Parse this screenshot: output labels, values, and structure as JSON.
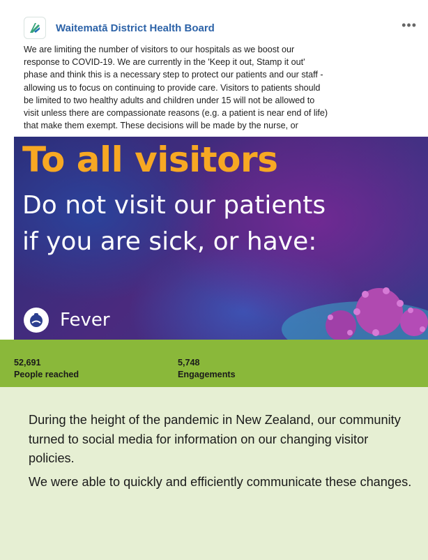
{
  "post": {
    "page_name": "Waitematā District Health Board",
    "more": "•••",
    "text_lines": [
      "We are limiting the number of visitors to our hospitals as we boost our",
      "response to COVID-19. We are currently in the 'Keep it out, Stamp it out'",
      "phase and think this is a necessary step to protect our patients and our staff -",
      "allowing us to focus on continuing to provide care. Visitors to patients should",
      "be limited to two healthy adults and children under 15 will not be allowed to",
      "visit unless there are compassionate reasons (e.g. a patient is near end of life)",
      "that make them exempt. These decisions will be made by the nurse, or"
    ]
  },
  "banner": {
    "headline": "To all visitors",
    "line2": "Do not visit our patients",
    "line3": "if you are sick, or have:",
    "symptom": "Fever"
  },
  "stats": {
    "reach_value": "52,691",
    "reach_label": "People reached",
    "engagement_value": "5,748",
    "engagement_label": "Engagements"
  },
  "summary": {
    "paragraph1": "During the height of the pandemic in New Zealand, our community turned to social media for information on our changing visitor policies.",
    "paragraph2": "We were able to quickly and efficiently communicate these changes."
  },
  "colors": {
    "headline": "#f7a823",
    "stats_bar": "#8ab83a",
    "summary_bg": "#e6efd3",
    "page_name": "#2d63a8"
  }
}
